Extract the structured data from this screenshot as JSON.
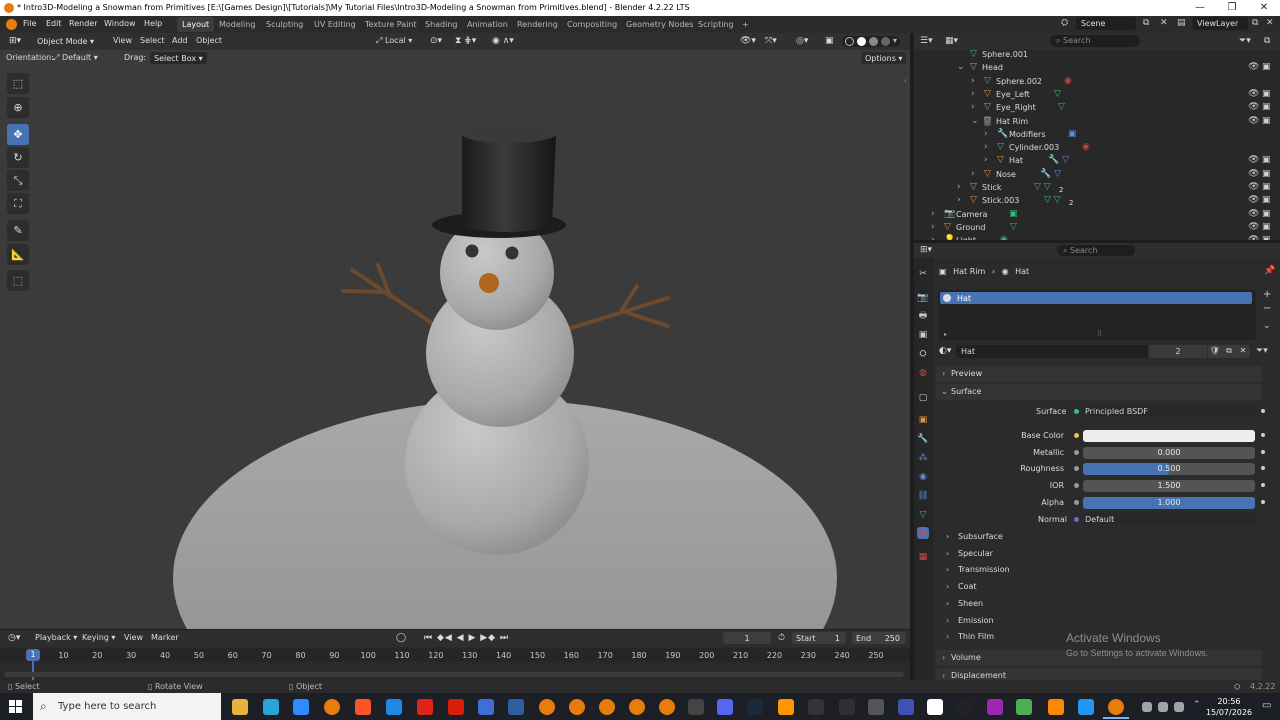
{
  "window": {
    "title": "* Intro3D-Modeling a Snowman from Primitives [E:\\[Games Design]\\[Tutorials]\\My Tutorial Files\\Intro3D-Modeling a Snowman from Primitives.blend] - Blender 4.2.22 LTS",
    "minimize": "—",
    "maximize": "❐",
    "close": "✕"
  },
  "menu": [
    "File",
    "Edit",
    "Render",
    "Window",
    "Help"
  ],
  "workspaces": [
    "Layout",
    "Modeling",
    "Sculpting",
    "UV Editing",
    "Texture Paint",
    "Shading",
    "Animation",
    "Rendering",
    "Compositing",
    "Geometry Nodes",
    "Scripting",
    "+"
  ],
  "scene": {
    "label": "Scene",
    "view_layer": "ViewLayer"
  },
  "viewport": {
    "mode": "Object Mode",
    "menus": [
      "View",
      "Select",
      "Add",
      "Object"
    ],
    "transform_space": "Local",
    "orientation_label": "Orientation:",
    "orientation_value": "Default",
    "drag_label": "Drag:",
    "drag_value": "Select Box",
    "options": "Options"
  },
  "outliner": {
    "search_placeholder": "Search",
    "rows": [
      {
        "name": "Sphere.001",
        "indent": 0
      },
      {
        "name": "Head",
        "indent": 0
      },
      {
        "name": "Sphere.002",
        "indent": 1
      },
      {
        "name": "Eye_Left",
        "indent": 1
      },
      {
        "name": "Eye_Right",
        "indent": 1
      },
      {
        "name": "Hat Rim",
        "indent": 1
      },
      {
        "name": "Modifiers",
        "indent": 2
      },
      {
        "name": "Cylinder.003",
        "indent": 2
      },
      {
        "name": "Hat",
        "indent": 2
      },
      {
        "name": "Nose",
        "indent": 1
      },
      {
        "name": "Stick",
        "indent": 0
      },
      {
        "name": "Stick.003",
        "indent": 0
      },
      {
        "name": "Camera",
        "indent": -1
      },
      {
        "name": "Ground",
        "indent": -1
      },
      {
        "name": "Light",
        "indent": -1
      }
    ],
    "stick_count": "2"
  },
  "properties": {
    "search_placeholder": "Search",
    "breadcrumb_object": "Hat Rim",
    "breadcrumb_material": "Hat",
    "slot_name": "Hat",
    "material_name": "Hat",
    "user_count": "2",
    "sections": {
      "preview": "Preview",
      "surface": "Surface"
    },
    "surface_label": "Surface",
    "surface_value": "Principled BSDF",
    "fields": [
      {
        "label": "Base Color",
        "value": "",
        "kind": "color",
        "color": "#eeeeee"
      },
      {
        "label": "Metallic",
        "value": "0.000",
        "kind": "plain"
      },
      {
        "label": "Roughness",
        "value": "0.500",
        "kind": "slider",
        "fill": 0.5
      },
      {
        "label": "IOR",
        "value": "1.500",
        "kind": "plain"
      },
      {
        "label": "Alpha",
        "value": "1.000",
        "kind": "slider",
        "fill": 1.0
      }
    ],
    "normal_label": "Normal",
    "normal_value": "Default",
    "subsections": [
      "Subsurface",
      "Specular",
      "Transmission",
      "Coat",
      "Sheen",
      "Emission",
      "Thin Film"
    ],
    "volume": "Volume",
    "displacement": "Displacement"
  },
  "watermark": {
    "line1": "Activate Windows",
    "line2": "Go to Settings to activate Windows."
  },
  "timeline": {
    "menus": [
      "Playback",
      "Keying",
      "View",
      "Marker"
    ],
    "current_frame": "1",
    "start_label": "Start",
    "start": "1",
    "end_label": "End",
    "end": "250",
    "ticks": [
      "1",
      "10",
      "20",
      "30",
      "40",
      "50",
      "60",
      "70",
      "80",
      "90",
      "100",
      "110",
      "120",
      "130",
      "140",
      "150",
      "160",
      "170",
      "180",
      "190",
      "200",
      "210",
      "220",
      "230",
      "240",
      "250"
    ]
  },
  "statusbar": {
    "select": "Select",
    "rotate": "Rotate View",
    "object": "Object",
    "version": "4.2.22"
  },
  "taskbar": {
    "search_placeholder": "Type here to search",
    "time": "20:56",
    "date": "15/07/2026"
  },
  "colors": {
    "accent": "#4772b3",
    "orange": "#e87d0d",
    "mesh_green": "#3fb97a",
    "object_orange": "#e0914b"
  }
}
